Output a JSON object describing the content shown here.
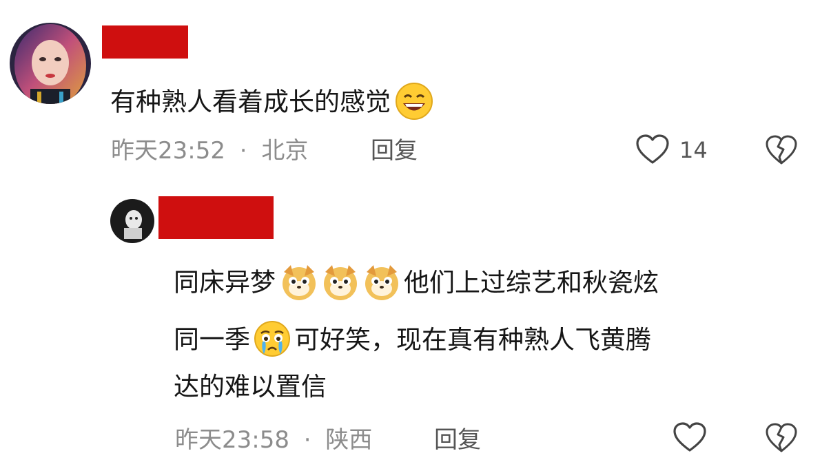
{
  "comments": [
    {
      "text": "有种熟人看着成长的感觉",
      "time": "昨天23:52",
      "location": "北京",
      "reply_label": "回复",
      "like_count": "14",
      "emoji": "grinning-face-emoji"
    },
    {
      "lines": [
        "同床异梦",
        "他们上过综艺和秋瓷炫",
        "同一季",
        "可好笑，现在真有种熟人飞黄腾",
        "达的难以置信"
      ],
      "time": "昨天23:58",
      "location": "陕西",
      "reply_label": "回复",
      "emojis": [
        "dog-face-emoji",
        "dog-face-emoji",
        "dog-face-emoji",
        "crying-face-emoji"
      ]
    }
  ],
  "separator": "·",
  "colors": {
    "redaction": "#cf0f0f",
    "meta_text": "#8c8c8c",
    "body_text": "#161616"
  },
  "icons": [
    "heart-outline-icon",
    "broken-heart-icon"
  ]
}
